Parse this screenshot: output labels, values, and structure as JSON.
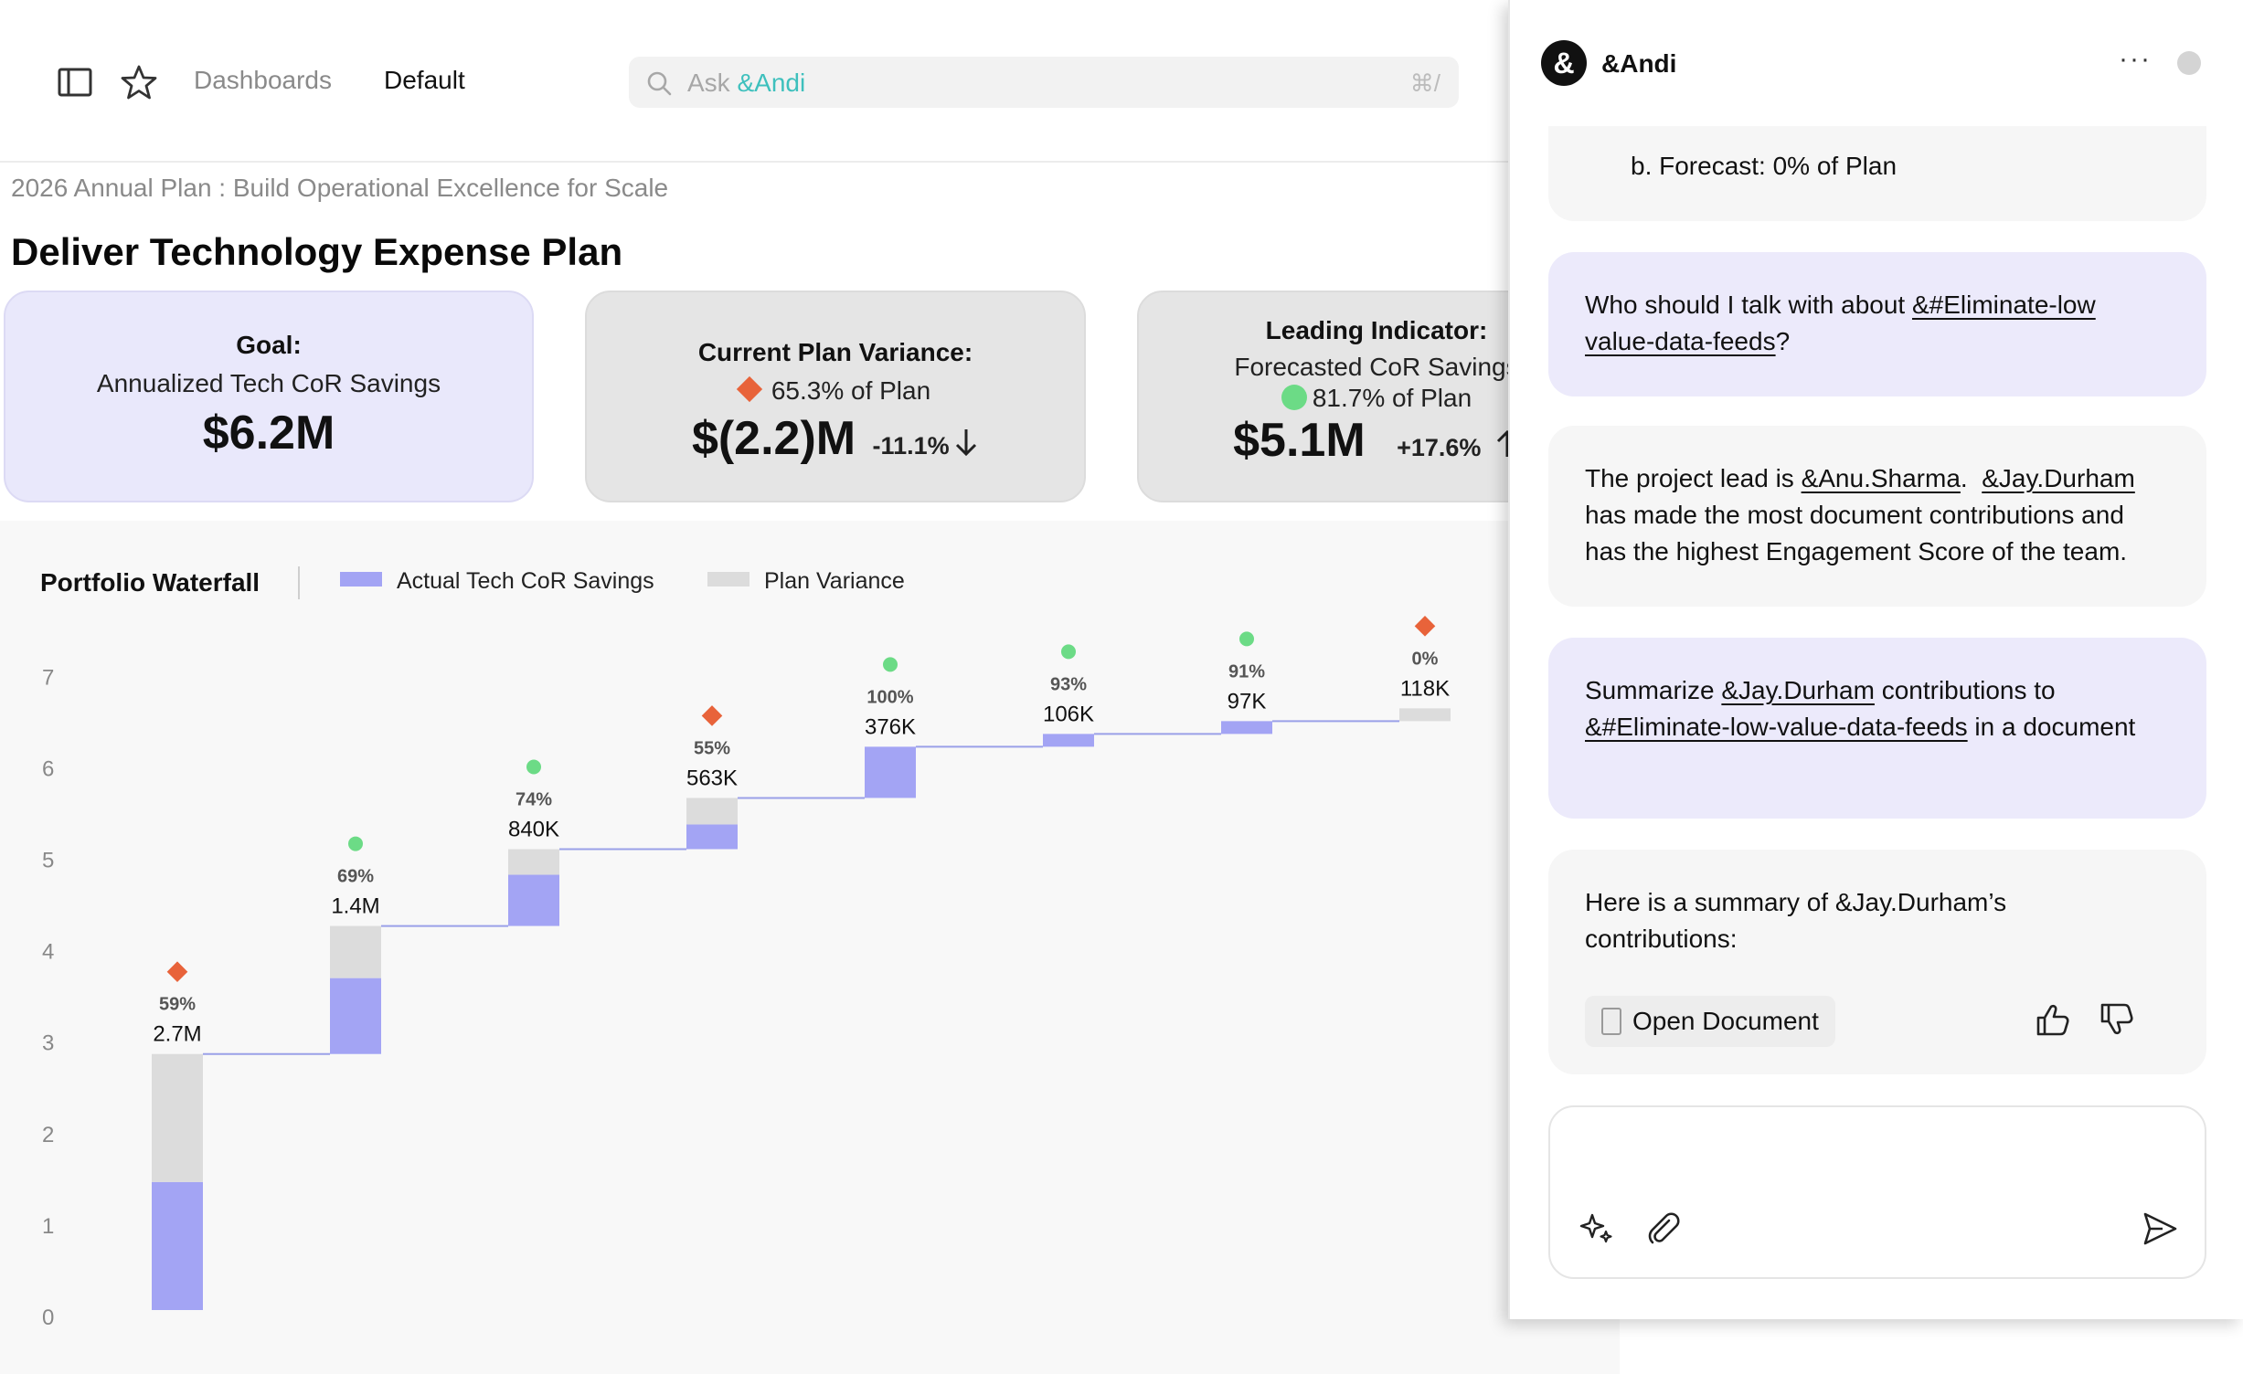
{
  "topbar": {
    "breadcrumb_dashboards": "Dashboards",
    "breadcrumb_current": "Default",
    "search_prefix": "Ask ",
    "search_brand": "&Andi",
    "search_shortcut": "⌘/"
  },
  "page": {
    "breadcrumb": "2026 Annual Plan : Build Operational Excellence for Scale",
    "title": "Deliver Technology Expense Plan"
  },
  "cards": {
    "goal": {
      "title": "Goal:",
      "subtitle": "Annualized Tech CoR Savings",
      "value": "$6.2M"
    },
    "variance": {
      "title": "Current Plan Variance:",
      "pct": "65.3% of Plan",
      "value": "$(2.2)M",
      "change": "-11.1%",
      "status_color": "#e8633a"
    },
    "leading": {
      "title": "Leading Indicator:",
      "subtitle": "Forecasted CoR Savings",
      "pct": "81.7% of Plan",
      "value": "$5.1M",
      "change": "+17.6%",
      "status_color": "#6cdb86"
    }
  },
  "chart_data": {
    "type": "bar",
    "title": "Portfolio Waterfall",
    "legend": [
      {
        "name": "Actual Tech CoR Savings",
        "color": "#a3a4f4"
      },
      {
        "name": "Plan Variance",
        "color": "#dcdcdc"
      }
    ],
    "ylim": [
      0,
      7
    ],
    "yticks": [
      0,
      1,
      2,
      3,
      4,
      5,
      6,
      7
    ],
    "steps": [
      {
        "start": 0.0,
        "actual": 1.4,
        "variance": 1.4,
        "label": "2.7M",
        "pct": "59%",
        "status": "diamond"
      },
      {
        "start": 2.8,
        "actual": 0.83,
        "variance": 0.57,
        "label": "1.4M",
        "pct": "69%",
        "status": "dot"
      },
      {
        "start": 4.2,
        "actual": 0.56,
        "variance": 0.28,
        "label": "840K",
        "pct": "74%",
        "status": "dot"
      },
      {
        "start": 5.04,
        "actual": 0.27,
        "variance": 0.29,
        "label": "563K",
        "pct": "55%",
        "status": "diamond"
      },
      {
        "start": 5.6,
        "actual": 0.56,
        "variance": 0.0,
        "label": "376K",
        "pct": "100%",
        "status": "dot"
      },
      {
        "start": 6.16,
        "actual": 0.14,
        "variance": 0.0,
        "label": "106K",
        "pct": "93%",
        "status": "dot"
      },
      {
        "start": 6.3,
        "actual": 0.14,
        "variance": 0.0,
        "label": "97K",
        "pct": "91%",
        "status": "dot"
      },
      {
        "start": 6.44,
        "actual": 0.0,
        "variance": 0.14,
        "label": "118K",
        "pct": "0%",
        "status": "diamond"
      }
    ],
    "colors": {
      "actual": "#a3a4f4",
      "variance": "#dcdcdc",
      "connector": "#9aa0e8",
      "dot": "#6cdb86",
      "diamond": "#e8633a"
    }
  },
  "chat": {
    "name": "&Andi",
    "logo": "&",
    "messages": {
      "forecast": "b. Forecast: 0% of Plan",
      "q1_prefix": "Who should I talk with about ",
      "q1_link": "&#Eliminate-low value-data-feeds",
      "q1_suffix": "?",
      "a1_prefix": "The project lead is ",
      "a1_lead": "&Anu.Sharma",
      "a1_sep": ".  ",
      "a1_contrib": "&Jay.Durham",
      "a1_suffix": " has made the most document contributions and has the highest Engagement Score of the team.",
      "q2_prefix": "Summarize ",
      "q2_person": "&Jay.Durham",
      "q2_mid": " contributions to ",
      "q2_link": "&#Eliminate-low-value-data-feeds",
      "q2_suffix": " in a document",
      "a2_text": "Here is a summary of &Jay.Durham’s contributions:",
      "open_document": "Open Document"
    }
  }
}
